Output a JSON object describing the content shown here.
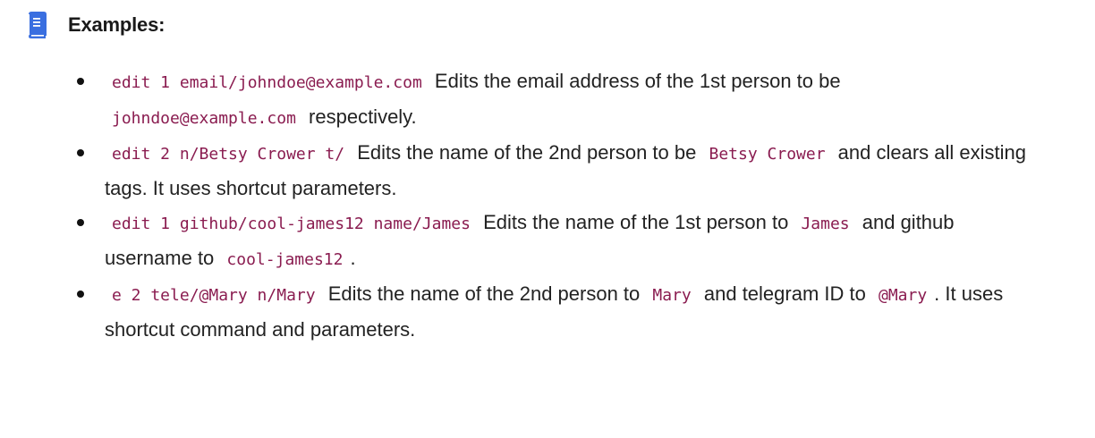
{
  "header": {
    "icon": "book-icon",
    "icon_color": "#3a6fe0",
    "title": "Examples:"
  },
  "items": [
    {
      "code1": "edit 1 email/johndoe@example.com",
      "text1": "Edits the email address of the 1st person to be",
      "code2": "johndoe@example.com",
      "text2": "respectively."
    },
    {
      "code1": "edit 2 n/Betsy Crower t/",
      "text1": "Edits the name of the 2nd person to be",
      "code2": "Betsy Crower",
      "text2": "and clears all existing tags. It uses shortcut parameters."
    },
    {
      "code1": "edit 1 github/cool-james12 name/James",
      "text1": "Edits the name of the 1st person to",
      "code2": "James",
      "text2": "and github username to",
      "code3": "cool-james12",
      "text3": "."
    },
    {
      "code1": "e 2 tele/@Mary n/Mary",
      "text1": "Edits the name of the 2nd person to",
      "code2": "Mary",
      "text2": "and telegram ID to",
      "code3": "@Mary",
      "text3": ". It uses shortcut command and parameters."
    }
  ],
  "colors": {
    "code_text": "#8a1c50",
    "body_text": "#222222",
    "icon_blue": "#3a6fe0"
  }
}
